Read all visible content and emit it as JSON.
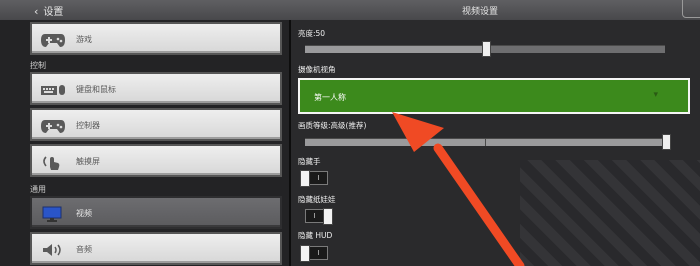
{
  "header": {
    "back_label": "设置",
    "title": "视频设置"
  },
  "sidebar": {
    "items_top": [
      {
        "label": "游戏",
        "icon": "gamepad-icon"
      }
    ],
    "section_controls": "控制",
    "controls_items": [
      {
        "label": "键盘和鼠标",
        "icon": "keyboard-mouse-icon"
      },
      {
        "label": "控制器",
        "icon": "controller-icon"
      },
      {
        "label": "触摸屏",
        "icon": "touch-icon"
      }
    ],
    "section_general": "通用",
    "general_items": [
      {
        "label": "视频",
        "icon": "monitor-icon",
        "selected": true
      },
      {
        "label": "音频",
        "icon": "speaker-icon"
      }
    ]
  },
  "settings": {
    "brightness_label": "亮度:50",
    "brightness_value": 0.5,
    "camera_label": "摄像机视角",
    "camera_value": "第一人称",
    "graphics_label": "画质等级:高级(推荐)",
    "graphics_value": 1.0,
    "hide_hand_label": "隐藏手",
    "hide_hand_on": false,
    "hide_paperdoll_label": "隐藏纸娃娃",
    "hide_paperdoll_on": true,
    "hide_hud_label": "隐藏 HUD",
    "hide_hud_on": false
  },
  "annotation": {
    "arrow_color": "#f04a24"
  }
}
